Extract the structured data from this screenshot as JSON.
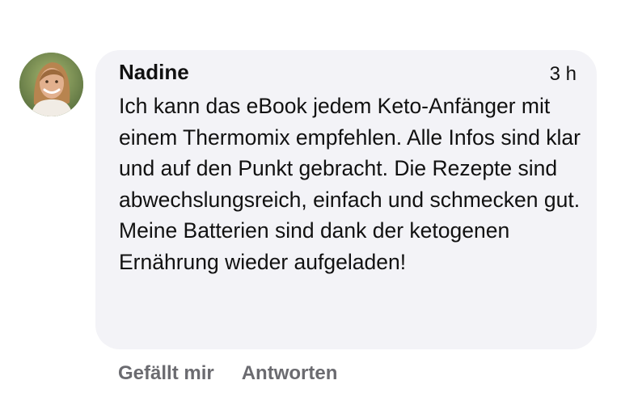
{
  "comment": {
    "author": "Nadine",
    "time": "3 h",
    "text": "Ich kann das eBook jedem Keto-Anfänger mit einem Thermomix empfehlen. Alle Infos sind klar und auf den Punkt gebracht. Die Rezepte sind abwechslungsreich, einfach und schmecken gut. Meine Batterien sind dank der ketogenen Ernährung wieder aufgeladen!",
    "avatar_icon": "user-avatar-photo"
  },
  "actions": {
    "like_label": "Gefällt mir",
    "reply_label": "Antworten"
  },
  "colors": {
    "bubble_background": "#f3f3f7",
    "action_text": "#6b6b70",
    "text": "#111111"
  }
}
